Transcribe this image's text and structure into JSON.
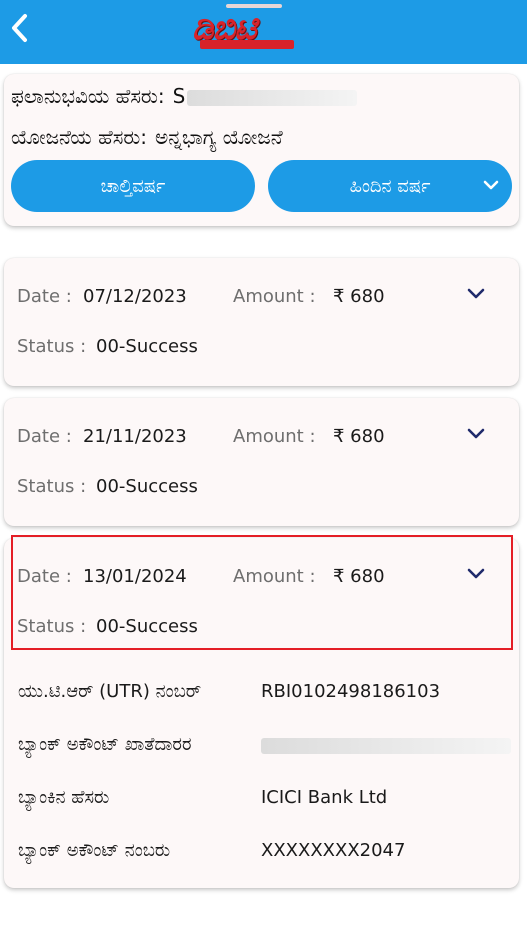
{
  "header": {
    "back_icon": "chevron-left-icon",
    "logo_text": "ಡಿಬಿಟಿ"
  },
  "beneficiary": {
    "name_label": "ಫಲಾನುಭವಿಯ ಹೆಸರು:",
    "name_value_visible": "S",
    "scheme_label": "ಯೋಜನೆಯ ಹೆಸರು:",
    "scheme_value": "ಅನ್ನಭಾಗ್ಯ ಯೋಜನೆ",
    "current_year_button": "ಚಾಲ್ತಿವರ್ಷ",
    "previous_year_button": "ಹಿಂದಿನ ವರ್ಷ"
  },
  "labels": {
    "date": "Date :",
    "amount": "Amount :",
    "status": "Status :"
  },
  "transactions": [
    {
      "date": "07/12/2023",
      "amount": "₹ 680",
      "status": "00-Success"
    },
    {
      "date": "21/11/2023",
      "amount": "₹ 680",
      "status": "00-Success"
    },
    {
      "date": "13/01/2024",
      "amount": "₹ 680",
      "status": "00-Success"
    }
  ],
  "details": [
    {
      "label": "ಯು.ಟಿ.ಆರ್ (UTR) ನಂಬರ್",
      "value": "RBI0102498186103"
    },
    {
      "label": "ಬ್ಯಾಂಕ್ ಅಕೌಂಟ್ ಖಾತೆದಾರರ",
      "value": ""
    },
    {
      "label": "ಬ್ಯಾಂಕಿನ ಹೆಸರು",
      "value": "ICICI Bank Ltd"
    },
    {
      "label": "ಬ್ಯಾಂಕ್ ಅಕೌಂಟ್ ನಂಬರು",
      "value": "XXXXXXXX2047"
    }
  ],
  "colors": {
    "primary": "#1d9be6",
    "highlight": "#e41e26",
    "card_bg": "#fdf8f8",
    "chevron": "#1f2a6b"
  }
}
